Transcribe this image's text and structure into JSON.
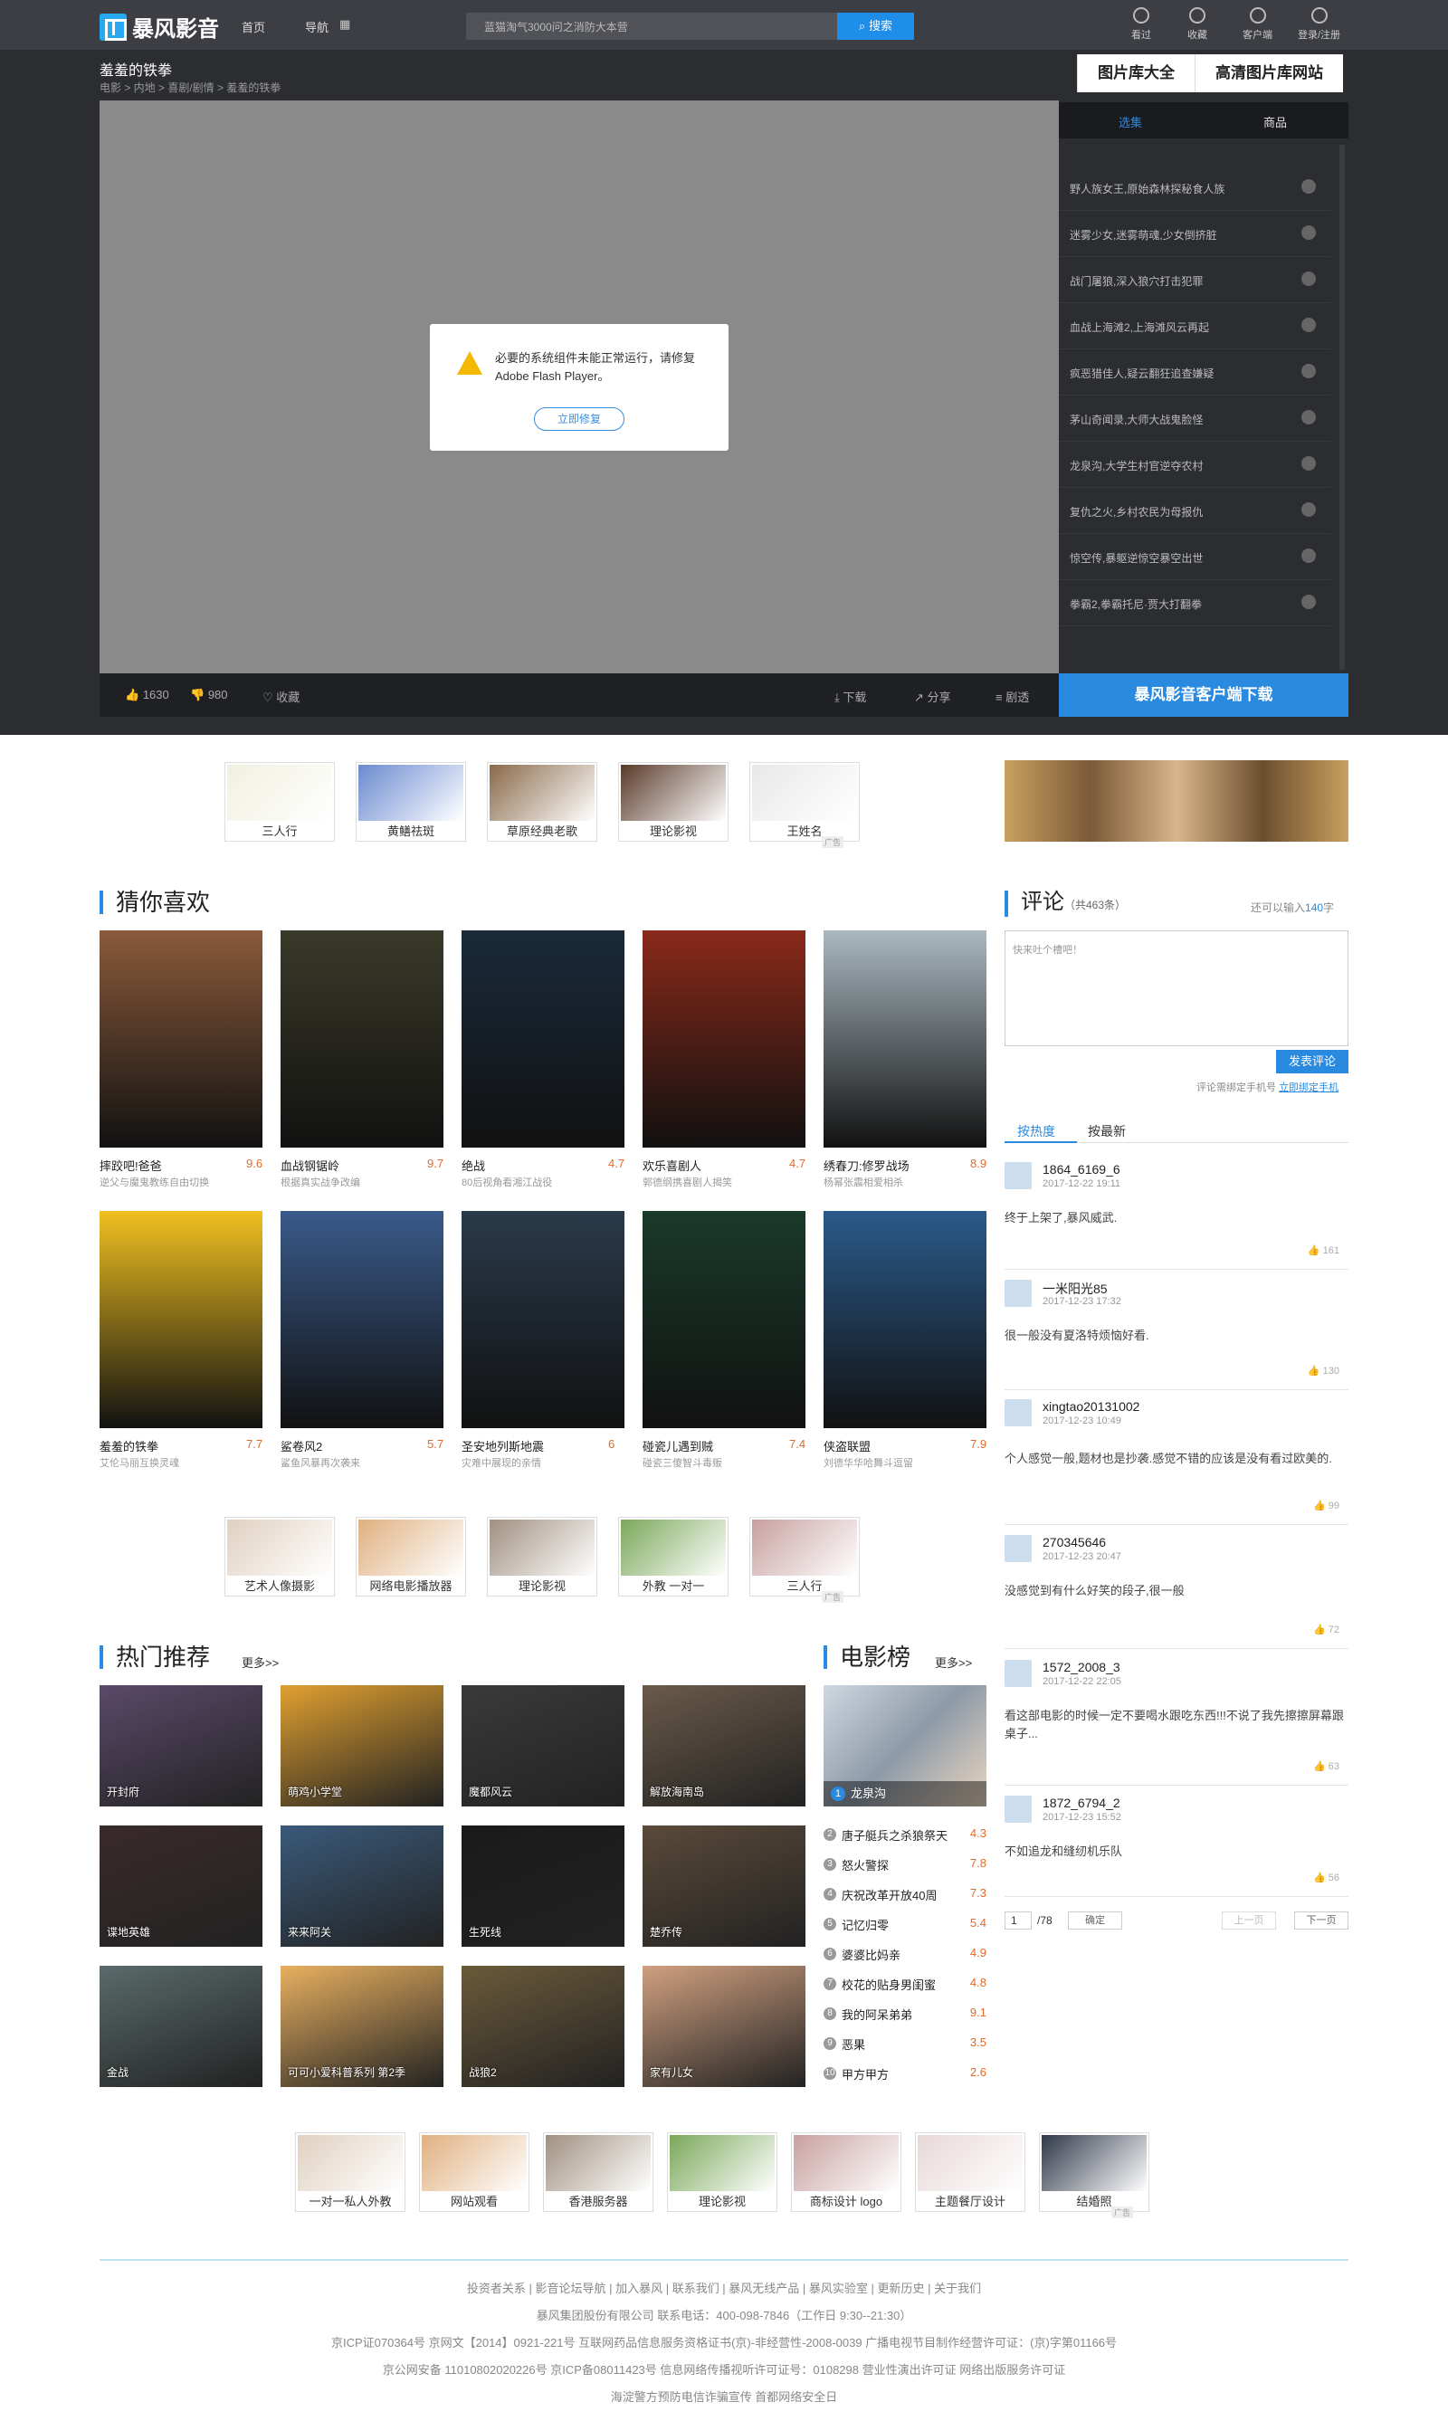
{
  "header": {
    "logo": "暴风影音",
    "nav_home": "首页",
    "nav_guide": "导航",
    "search_placeholder": "蓝猫淘气3000问之消防大本营",
    "search_btn": "搜索",
    "icons": [
      {
        "label": "看过"
      },
      {
        "label": "收藏"
      },
      {
        "label": "客户端"
      },
      {
        "label": "登录/注册"
      }
    ]
  },
  "player": {
    "title": "羞羞的铁拳",
    "breadcrumb": "电影 > 内地 > 喜剧/剧情 > 羞羞的铁拳",
    "flash_msg": "必要的系统组件未能正常运行，请修复 Adobe Flash Player。",
    "fix_btn": "立即修复",
    "likes": "1630",
    "dislikes": "980",
    "fav": "收藏",
    "download": "下载",
    "share": "分享",
    "danmaku": "剧透"
  },
  "side": {
    "tab_big_1": "图片库大全",
    "tab_big_2": "高清图片库网站",
    "tab_1": "选集",
    "tab_2": "商品",
    "items": [
      "野人族女王,原始森林探秘食人族",
      "迷雾少女,迷雾萌魂,少女倒挤脏",
      "战门屠狼,深入狼穴打击犯罪",
      "血战上海滩2,上海滩风云再起",
      "疯恶猎佳人,疑云翻狂追查嫌疑",
      "茅山奇闻录,大师大战鬼脸怪",
      "龙泉沟,大学生村官逆夺农村",
      "复仇之火,乡村农民为母报仇",
      "惊空传,暴躯逆惊空暴空出世",
      "拳霸2,拳霸托尼·贾大打翻拳"
    ],
    "client_dl": "暴风影音客户端下载"
  },
  "ads_row1": [
    "三人行",
    "黄鳝祛斑",
    "草原经典老歌",
    "理论影视",
    "王姓名"
  ],
  "ad_tag": "广告",
  "guess": {
    "title": "猜你喜欢",
    "items": [
      {
        "name": "摔跤吧!爸爸",
        "desc": "逆父与魔鬼教练自由切换",
        "score": "9.6"
      },
      {
        "name": "血战钢锯岭",
        "desc": "根据真实战争改编",
        "score": "9.7"
      },
      {
        "name": "绝战",
        "desc": "80后视角看湘江战役",
        "score": "4.7"
      },
      {
        "name": "欢乐喜剧人",
        "desc": "郭德纲携喜剧人揭笑",
        "score": "4.7"
      },
      {
        "name": "绣春刀:修罗战场",
        "desc": "杨幂张震相爱相杀",
        "score": "8.9"
      },
      {
        "name": "羞羞的铁拳",
        "desc": "艾伦马丽互换灵魂",
        "score": "7.7"
      },
      {
        "name": "鲨卷风2",
        "desc": "鲨鱼风暴再次袭来",
        "score": "5.7"
      },
      {
        "name": "圣安地列斯地震",
        "desc": "灾难中展现的亲情",
        "score": "6"
      },
      {
        "name": "碰瓷儿遇到贼",
        "desc": "碰瓷三傻智斗毒贩",
        "score": "7.4"
      },
      {
        "name": "侠盗联盟",
        "desc": "刘德华华哈舞斗逗留",
        "score": "7.9"
      }
    ]
  },
  "ads_row2": [
    "艺术人像摄影",
    "网络电影播放器",
    "理论影视",
    "外教 一对一",
    "三人行"
  ],
  "hot": {
    "title": "热门推荐",
    "more": "更多>>",
    "items": [
      "开封府",
      "萌鸡小学堂",
      "魔都风云",
      "解放海南岛",
      "谍地英雄",
      "来来阿关",
      "生死线",
      "楚乔传",
      "金战",
      "可可小爱科普系列 第2季",
      "战狼2",
      "家有儿女"
    ]
  },
  "rank": {
    "title": "电影榜",
    "more": "更多>>",
    "top": "龙泉沟",
    "items": [
      {
        "n": "2",
        "t": "唐子艇兵之杀狼祭天",
        "s": "4.3"
      },
      {
        "n": "3",
        "t": "怒火警探",
        "s": "7.8"
      },
      {
        "n": "4",
        "t": "庆祝改革开放40周",
        "s": "7.3"
      },
      {
        "n": "5",
        "t": "记忆归零",
        "s": "5.4"
      },
      {
        "n": "6",
        "t": "婆婆比妈亲",
        "s": "4.9"
      },
      {
        "n": "7",
        "t": "校花的贴身男闺蜜",
        "s": "4.8"
      },
      {
        "n": "8",
        "t": "我的阿呆弟弟",
        "s": "9.1"
      },
      {
        "n": "9",
        "t": "恶果",
        "s": "3.5"
      },
      {
        "n": "10",
        "t": "甲方甲方",
        "s": "2.6"
      }
    ]
  },
  "comments": {
    "title": "评论",
    "count": "（共463条）",
    "remain_pre": "还可以输入",
    "remain_num": "140",
    "remain_post": "字",
    "placeholder": "快来吐个槽吧！",
    "submit": "发表评论",
    "bind_note": "评论需绑定手机号",
    "bind_link": "立即绑定手机",
    "tab_hot": "按热度",
    "tab_new": "按最新",
    "items": [
      {
        "user": "1864_6169_6",
        "date": "2017-12-22 19:11",
        "text": "终于上架了,暴风威武.",
        "likes": "161"
      },
      {
        "user": "一米阳光85",
        "date": "2017-12-23 17:32",
        "text": "很一般没有夏洛特烦恼好看.",
        "likes": "130"
      },
      {
        "user": "xingtao20131002",
        "date": "2017-12-23 10:49",
        "text": "个人感觉一般,题材也是抄袭.感觉不错的应该是没有看过欧美的.",
        "likes": "99"
      },
      {
        "user": "270345646",
        "date": "2017-12-23 20:47",
        "text": "没感觉到有什么好笑的段子,很一般",
        "likes": "72"
      },
      {
        "user": "1572_2008_3",
        "date": "2017-12-22 22:05",
        "text": "看这部电影的时候一定不要喝水跟吃东西!!!不说了我先擦擦屏幕跟桌子...",
        "likes": "63"
      },
      {
        "user": "1872_6794_2",
        "date": "2017-12-23 15:52",
        "text": "不如追龙和缝纫机乐队",
        "likes": "56"
      }
    ],
    "page": "1",
    "pages": "/78",
    "confirm": "确定",
    "prev": "上一页",
    "next": "下一页"
  },
  "ads_row3": [
    "一对一私人外教",
    "网站观看",
    "香港服务器",
    "理论影视",
    "商标设计 logo",
    "主题餐厅设计",
    "结婚照"
  ],
  "footer": {
    "links": "投资者关系 | 影音论坛导航 | 加入暴风 | 联系我们 | 暴风无线产品 | 暴风实验室 | 更新历史 | 关于我们",
    "company": "暴风集团股份有限公司 联系电话：400-098-7846（工作日 9:30--21:30）",
    "line3": "京ICP证070364号    京网文【2014】0921-221号    互联网药品信息服务资格证书(京)-非经营性-2008-0039    广播电视节目制作经营许可证：(京)字第01166号",
    "line4": "京公网安备 11010802020226号    京ICP备08011423号    信息网络传播视听许可证号：0108298    营业性演出许可证    网络出版服务许可证",
    "line5": "海淀警方预防电信诈骗宣传    首都网络安全日"
  }
}
